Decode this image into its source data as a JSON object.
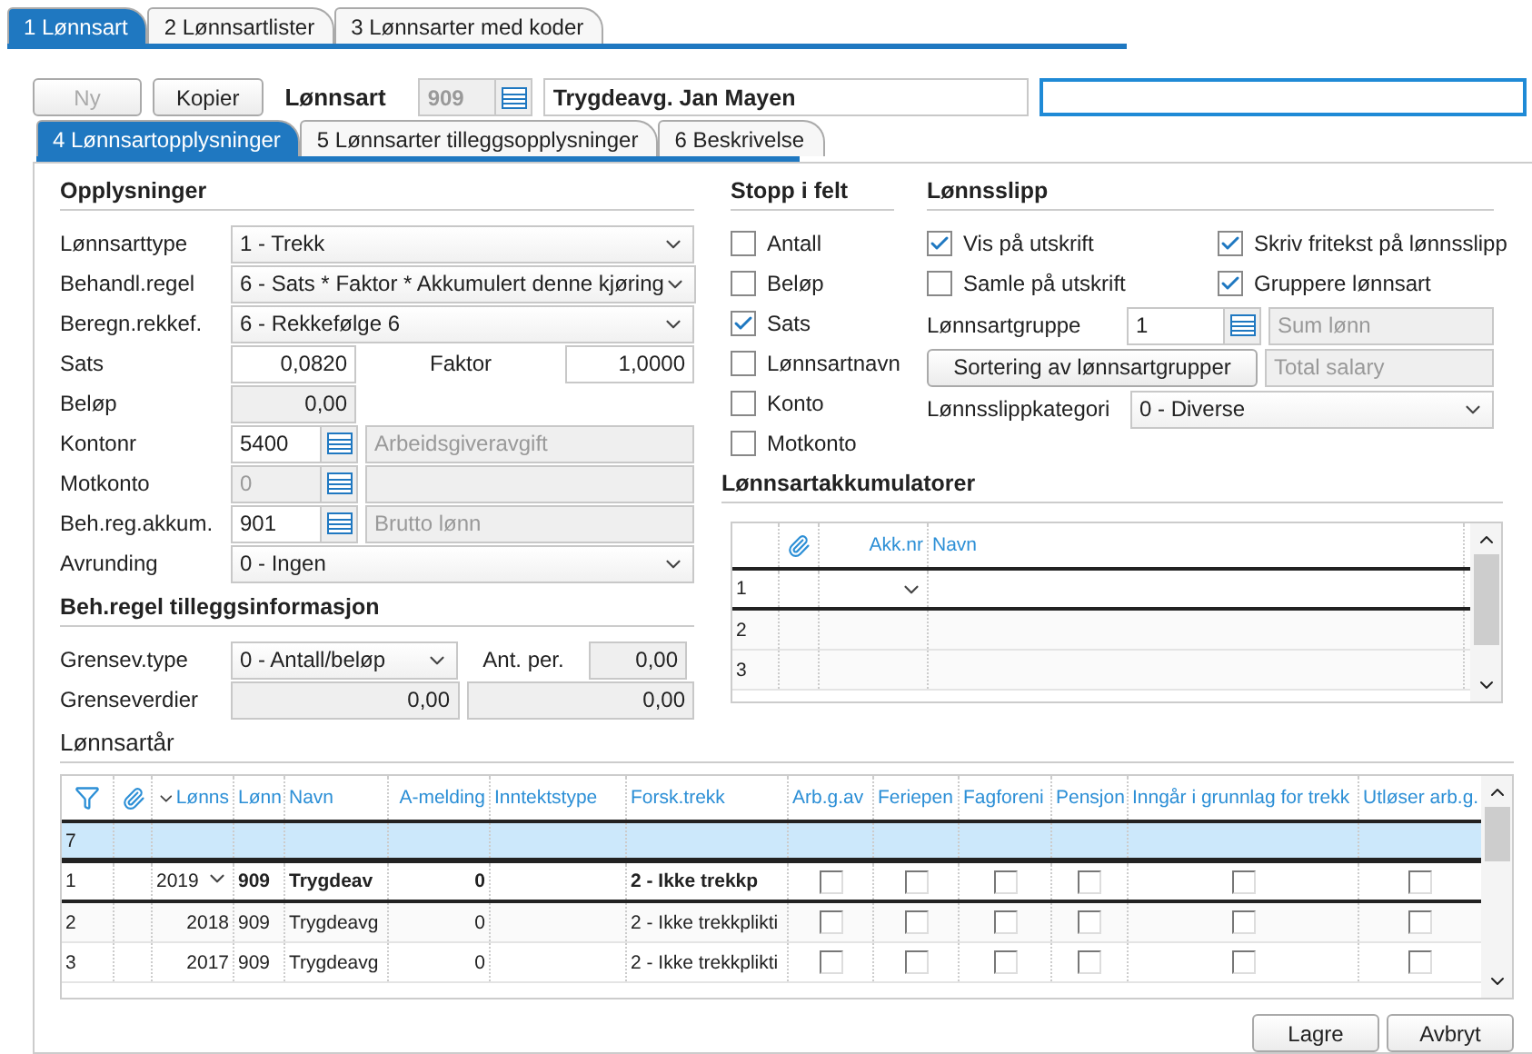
{
  "main_tabs": [
    {
      "label": "1 Lønnsart",
      "selected": true
    },
    {
      "label": "2 Lønnsartlister",
      "selected": false
    },
    {
      "label": "3 Lønnsarter med koder",
      "selected": false
    }
  ],
  "toolbar": {
    "new_button": {
      "label": "Ny",
      "disabled": true
    },
    "copy_button": {
      "label": "Kopier",
      "disabled": false
    },
    "field_label": "Lønnsart",
    "number": "909",
    "name": "Trygdeavg. Jan Mayen"
  },
  "sub_tabs": [
    {
      "label": "4 Lønnsartopplysninger",
      "selected": true
    },
    {
      "label": "5 Lønnsarter tilleggsopplysninger",
      "selected": false
    },
    {
      "label": "6 Beskrivelse",
      "selected": false
    }
  ],
  "opplysninger": {
    "title": "Opplysninger",
    "rows": [
      {
        "kind": "select",
        "label": "Lønnsarttype",
        "value": "1 - Trekk"
      },
      {
        "kind": "select",
        "label": "Behandl.regel",
        "value": "6 - Sats * Faktor * Akkumulert denne kjøring"
      },
      {
        "kind": "select",
        "label": "Beregn.rekkef.",
        "value": "6 - Rekkefølge 6"
      },
      {
        "kind": "pair",
        "label": "Sats",
        "value": "0,0820",
        "label2": "Faktor",
        "value2": "1,0000"
      },
      {
        "kind": "readonly",
        "label": "Beløp",
        "value": "0,00"
      },
      {
        "kind": "lookup",
        "label": "Kontonr",
        "value": "5400",
        "disabled": false,
        "description": "Arbeidsgiveravgift"
      },
      {
        "kind": "lookup",
        "label": "Motkonto",
        "value": "0",
        "disabled": true
      },
      {
        "kind": "lookup",
        "label": "Beh.reg.akkum.",
        "value": "901",
        "disabled": false,
        "description": "Brutto lønn"
      },
      {
        "kind": "select",
        "label": "Avrunding",
        "value": "0 - Ingen"
      }
    ]
  },
  "tilleggsinfo": {
    "title": "Beh.regel tilleggsinformasjon",
    "type_label": "Grensev.type",
    "type_value": "0 - Antall/beløp",
    "per_label": "Ant. per.",
    "per_value": "0,00",
    "values_label": "Grenseverdier",
    "values": [
      "0,00",
      "0,00"
    ]
  },
  "stopp": {
    "title": "Stopp i felt",
    "items": [
      {
        "label": "Antall",
        "checked": false
      },
      {
        "label": "Beløp",
        "checked": false
      },
      {
        "label": "Sats",
        "checked": true
      },
      {
        "label": "Lønnsartnavn",
        "checked": false
      },
      {
        "label": "Konto",
        "checked": false
      },
      {
        "label": "Motkonto",
        "checked": false
      }
    ]
  },
  "lonnsslipp": {
    "title": "Lønnsslipp",
    "checks": [
      {
        "label": "Vis på utskrift",
        "checked": true
      },
      {
        "label": "Skriv fritekst på lønnsslipp",
        "checked": true
      },
      {
        "label": "Samle på utskrift",
        "checked": false
      },
      {
        "label": "Gruppere lønnsart",
        "checked": true
      }
    ],
    "group_label": "Lønnsartgruppe",
    "group_code": "1",
    "group_name": "Sum lønn",
    "sort_button": "Sortering av lønnsartgrupper",
    "sort_name": "Total salary",
    "category_label": "Lønnsslippkategori",
    "category_value": "0 - Diverse"
  },
  "akkumulatorer": {
    "title": "Lønnsartakkumulatorer",
    "columns": [
      "Akk.nr",
      "Navn"
    ],
    "rows": [
      "1",
      "2",
      "3"
    ]
  },
  "lonnsartar": {
    "title": "Lønnsartår",
    "columns": [
      "Lønns",
      "Lønn",
      "Navn",
      "A-melding",
      "Inntektstype",
      "Forsk.trekk",
      "Arb.g.av",
      "Feriepen",
      "Fagforeni",
      "Pensjon",
      "Inngår i grunnlag for trekk",
      "Utløser arb.g."
    ],
    "filter_row": "7",
    "rows": [
      {
        "index": "1",
        "selected": true,
        "year": "2019",
        "nr": "909",
        "name": "Trygdeav",
        "amelding": "0",
        "forsk": "2 - Ikke trekkp",
        "flags": [
          false,
          false,
          false,
          false,
          false,
          false
        ]
      },
      {
        "index": "2",
        "selected": false,
        "year": "2018",
        "nr": "909",
        "name": "Trygdeavg",
        "amelding": "0",
        "forsk": "2 - Ikke trekkplikti",
        "flags": [
          false,
          false,
          false,
          false,
          false,
          false
        ]
      },
      {
        "index": "3",
        "selected": false,
        "year": "2017",
        "nr": "909",
        "name": "Trygdeavg",
        "amelding": "0",
        "forsk": "2 - Ikke trekkplikti",
        "flags": [
          false,
          false,
          false,
          false,
          false,
          false
        ]
      }
    ]
  },
  "buttons": [
    "Lagre",
    "Avbryt"
  ]
}
